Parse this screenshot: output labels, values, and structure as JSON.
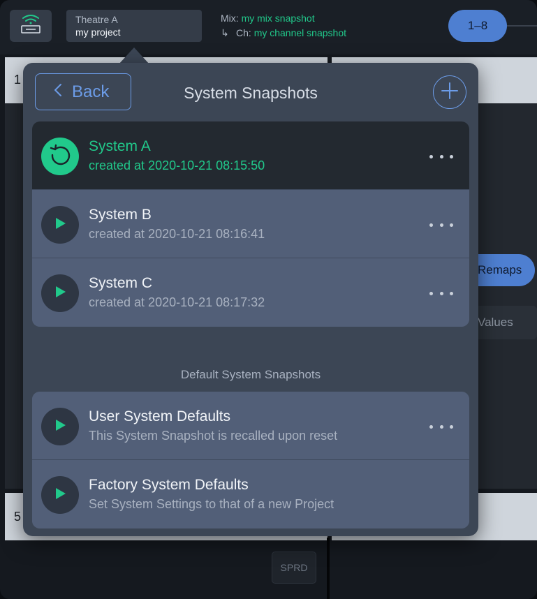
{
  "topbar": {
    "project_venue": "Theatre A",
    "project_name": "my project",
    "mix_label": "Mix:",
    "mix_value": "my mix snapshot",
    "channel_arrow": "↳",
    "channel_label": "Ch:",
    "channel_value": "my channel snapshot",
    "bank_label": "1–8"
  },
  "background": {
    "strip1_number": "1",
    "strip5_number": "5",
    "remaps_label": "Remaps",
    "values_label": "Values",
    "sprd_label": "SPRD"
  },
  "popover": {
    "back_label": "Back",
    "title": "System Snapshots",
    "snapshots": [
      {
        "title": "System A",
        "subtitle": "created at 2020-10-21 08:15:50",
        "active": true
      },
      {
        "title": "System B",
        "subtitle": "created at 2020-10-21 08:16:41",
        "active": false
      },
      {
        "title": "System C",
        "subtitle": "created at 2020-10-21 08:17:32",
        "active": false
      }
    ],
    "defaults_header": "Default System Snapshots",
    "defaults": [
      {
        "title": "User System Defaults",
        "subtitle": "This System Snapshot is recalled upon reset"
      },
      {
        "title": "Factory System Defaults",
        "subtitle": "Set System Settings to that of a new Project"
      }
    ]
  },
  "colors": {
    "accent_green": "#21c98b",
    "accent_blue": "#6c9ce8",
    "popover_bg": "#3c4655",
    "row_bg": "#525f78",
    "active_row_bg": "#232930"
  },
  "icons": {
    "network": "wifi-device-icon",
    "back": "chevron-left-icon",
    "add": "plus-icon",
    "recall": "recall-icon",
    "play": "play-icon",
    "more": "more-dots-icon"
  }
}
